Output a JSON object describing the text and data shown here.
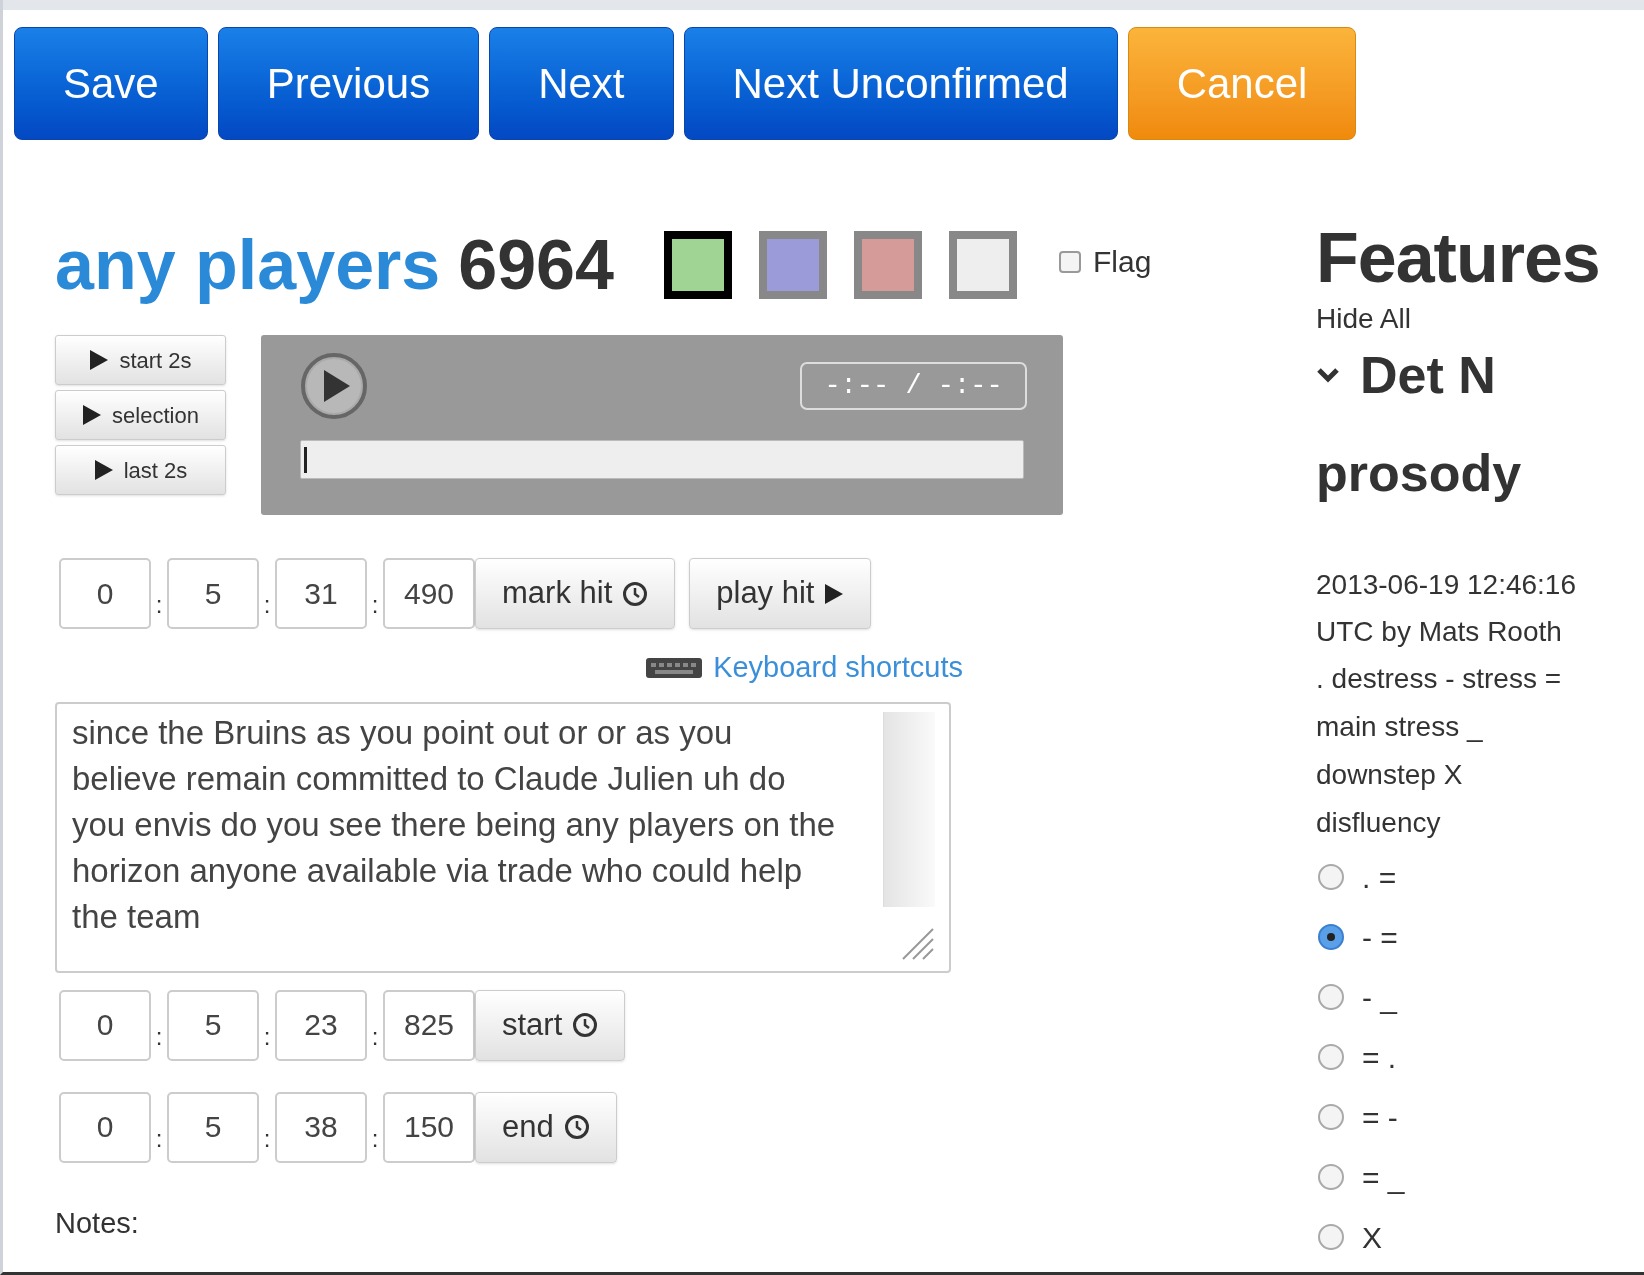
{
  "toolbar": [
    {
      "label": "Save",
      "kind": "primary"
    },
    {
      "label": "Previous",
      "kind": "primary"
    },
    {
      "label": "Next",
      "kind": "primary"
    },
    {
      "label": "Next Unconfirmed",
      "kind": "primary"
    },
    {
      "label": "Cancel",
      "kind": "warning"
    }
  ],
  "title": {
    "phrase": "any players",
    "number": "6964"
  },
  "swatches": [
    {
      "color": "#a0d495",
      "selected": true
    },
    {
      "color": "#9b9bd9",
      "selected": false
    },
    {
      "color": "#d49b98",
      "selected": false
    },
    {
      "color": "#eeeeee",
      "selected": false
    }
  ],
  "flag": {
    "label": "Flag",
    "checked": false
  },
  "play_buttons": [
    "start 2s",
    "selection",
    "last 2s"
  ],
  "player": {
    "time": "-:-- / -:--",
    "level": 0
  },
  "separator": ":",
  "hit": {
    "fields": [
      "0",
      "5",
      "31",
      "490"
    ],
    "mark_button": "mark hit",
    "play_button": "play hit"
  },
  "keyboard_link": "Keyboard shortcuts",
  "transcript": "since the Bruins as you point out or or as you believe remain committed to Claude Julien uh do you envis do you see there being any players on the horizon anyone available via trade who could help the team",
  "start": {
    "fields": [
      "0",
      "5",
      "23",
      "825"
    ],
    "button": "start"
  },
  "end": {
    "fields": [
      "0",
      "5",
      "38",
      "150"
    ],
    "button": "end"
  },
  "notes_label": "Notes:",
  "features": {
    "title": "Features",
    "hide_all": "Hide All",
    "group": {
      "title": "Det N",
      "expanded": true
    },
    "section": "prosody",
    "meta": "2013-06-19 12:46:16 UTC by Mats Rooth",
    "legend": [
      ". destress - stress =",
      "main stress _",
      "downstep X",
      "disfluency"
    ],
    "options": [
      {
        "label": ". =",
        "selected": false
      },
      {
        "label": "- =",
        "selected": true
      },
      {
        "label": "- _",
        "selected": false
      },
      {
        "label": "= .",
        "selected": false
      },
      {
        "label": "= -",
        "selected": false
      },
      {
        "label": "= _",
        "selected": false
      },
      {
        "label": "X",
        "selected": false
      }
    ]
  }
}
